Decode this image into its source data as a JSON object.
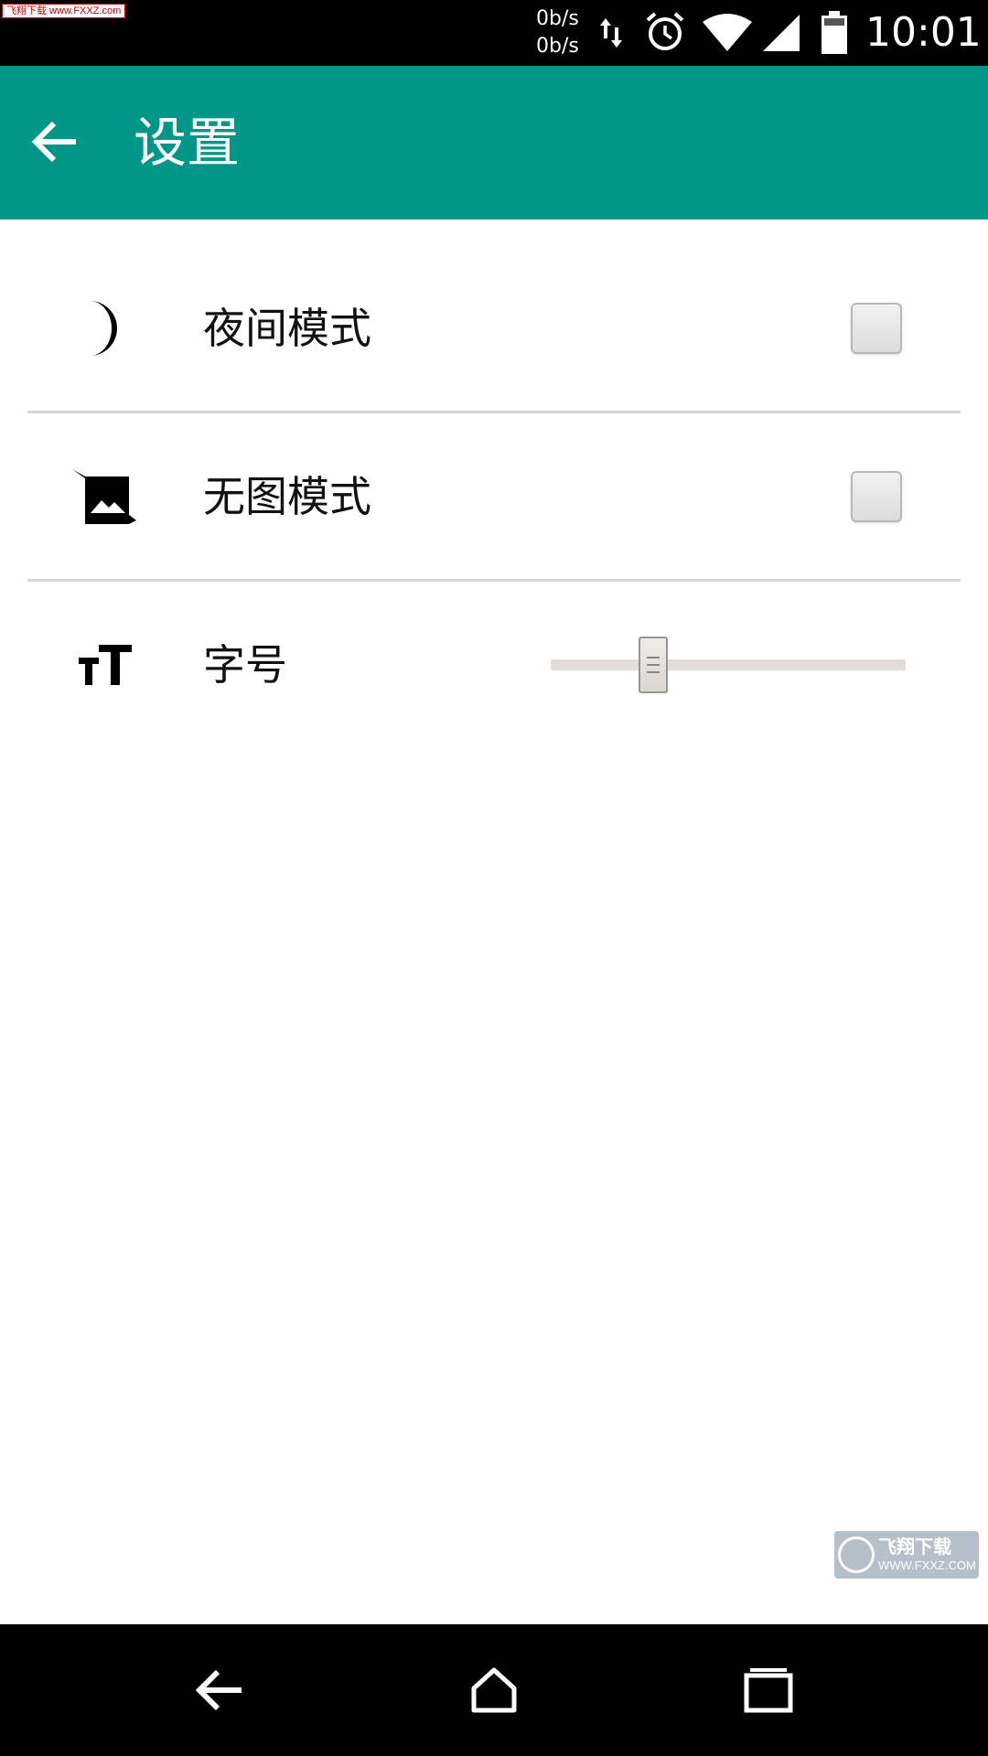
{
  "status_bar": {
    "watermark": "飞翔下载 www.FXXZ.com",
    "net_speed_up": "0b/s",
    "net_speed_down": "0b/s",
    "time": "10:01",
    "icons": [
      "data-transfer-icon",
      "alarm-icon",
      "wifi-icon",
      "signal-icon",
      "battery-icon"
    ]
  },
  "app_bar": {
    "title": "设置",
    "background": "#009688"
  },
  "settings": {
    "night_mode": {
      "label": "夜间模式",
      "icon": "moon-icon",
      "checked": false
    },
    "no_image_mode": {
      "label": "无图模式",
      "icon": "image-off-icon",
      "checked": false
    },
    "font_size": {
      "label": "字号",
      "icon": "text-size-icon",
      "slider_fraction": 0.27
    }
  },
  "watermark_bottom": {
    "text_cn": "飞翔下载",
    "text_en": "WWW.FXXZ.COM"
  }
}
